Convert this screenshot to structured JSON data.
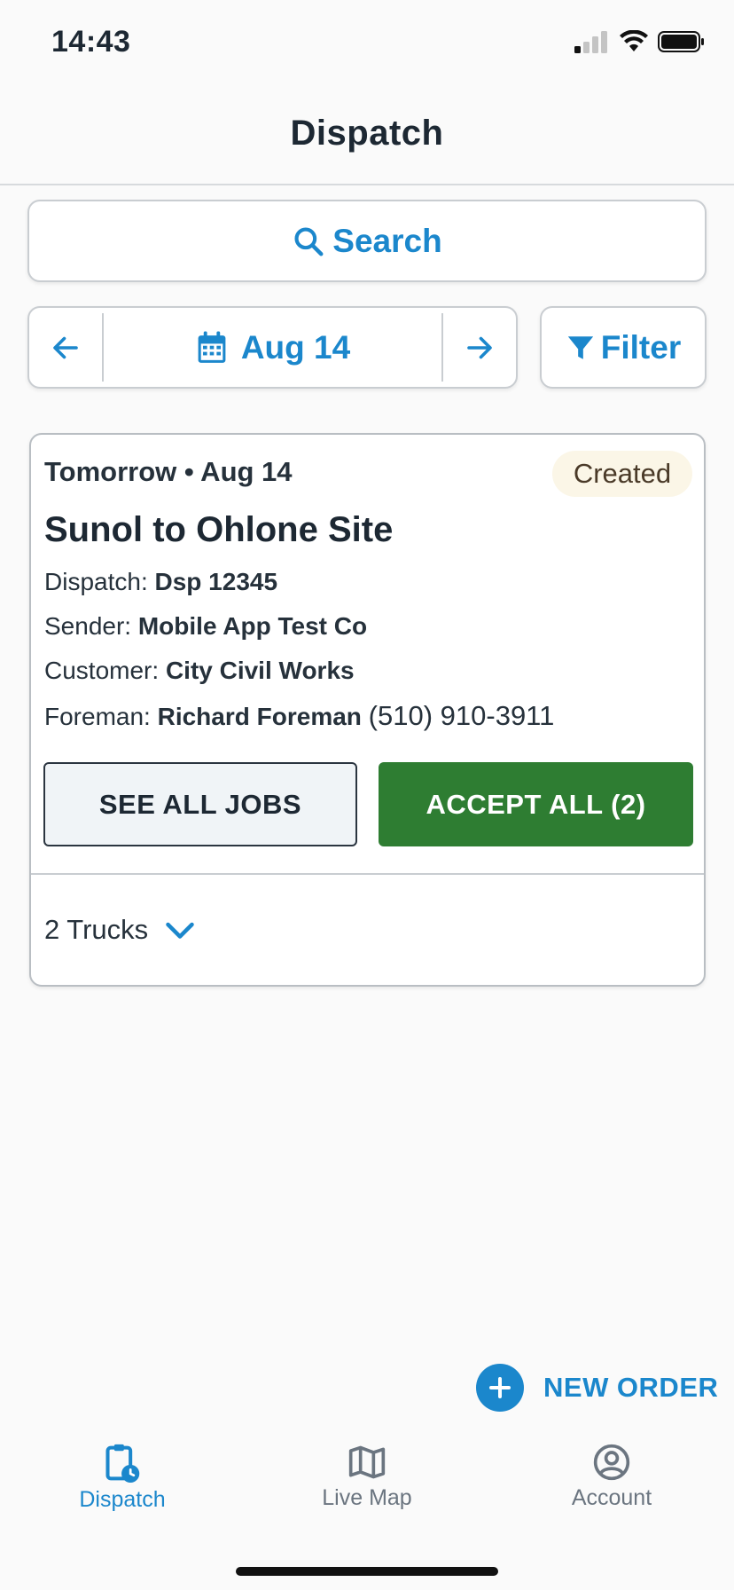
{
  "status_bar": {
    "time": "14:43"
  },
  "header": {
    "title": "Dispatch"
  },
  "search": {
    "label": "Search"
  },
  "date_nav": {
    "date": "Aug 14"
  },
  "filter": {
    "label": "Filter"
  },
  "card": {
    "date": "Tomorrow • Aug 14",
    "status": "Created",
    "title": "Sunol to Ohlone Site",
    "dispatch_label": "Dispatch:",
    "dispatch_value": "Dsp 12345",
    "sender_label": "Sender:",
    "sender_value": "Mobile App Test Co",
    "customer_label": "Customer:",
    "customer_value": "City Civil Works",
    "foreman_label": "Foreman:",
    "foreman_value": "Richard Foreman",
    "foreman_phone": "(510) 910-3911",
    "see_all_label": "SEE ALL JOBS",
    "accept_all_label": "ACCEPT ALL (2)",
    "trucks_label": "2 Trucks"
  },
  "new_order": {
    "label": "NEW ORDER"
  },
  "tabs": [
    {
      "label": "Dispatch",
      "icon": "clipboard-clock-icon",
      "active": true
    },
    {
      "label": "Live Map",
      "icon": "map-icon",
      "active": false
    },
    {
      "label": "Account",
      "icon": "account-circle-icon",
      "active": false
    }
  ],
  "colors": {
    "accent": "#1b87cc",
    "accept_green": "#2e7d32",
    "badge_bg": "#fbf6e7"
  }
}
